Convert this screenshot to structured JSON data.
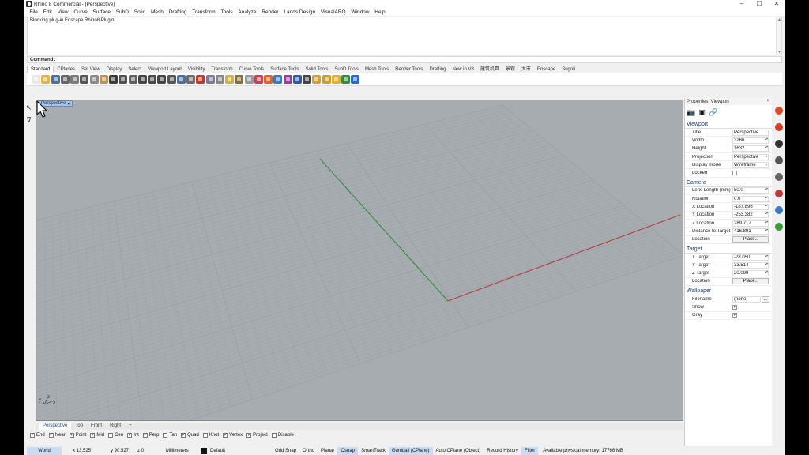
{
  "window": {
    "title": "Rhino 8 Commercial - [Perspective]",
    "controls": [
      "–",
      "☐",
      "✕"
    ]
  },
  "menu": [
    "File",
    "Edit",
    "View",
    "Curve",
    "Surface",
    "SubD",
    "Solid",
    "Mesh",
    "Drafting",
    "Transform",
    "Tools",
    "Analyze",
    "Render",
    "Lands Design",
    "VisualARQ",
    "Window",
    "Help"
  ],
  "command_history": [
    "Blocking plug-in Enscape.Rhino8.Plugin."
  ],
  "command_prompt": "Command:",
  "toolbar_tabs": [
    "Standard",
    "CPlanes",
    "Set View",
    "Display",
    "Select",
    "Viewport Layout",
    "Visibility",
    "Transform",
    "Curve Tools",
    "Surface Tools",
    "Solid Tools",
    "SubD Tools",
    "Mesh Tools",
    "Render Tools",
    "Drafting",
    "New in V8",
    "建筑机具",
    "景观",
    "大市",
    "Enscape",
    "Sugoii"
  ],
  "toolbar_active_tab": "Standard",
  "toolbar_icons": [
    {
      "name": "new-icon",
      "color": "#e8e8e8"
    },
    {
      "name": "open-icon",
      "color": "#e2b64a"
    },
    {
      "name": "save-icon",
      "color": "#4a6fa8"
    },
    {
      "name": "print-icon",
      "color": "#666666"
    },
    {
      "name": "import-icon",
      "color": "#7a7a7a"
    },
    {
      "name": "cut-icon",
      "color": "#555555"
    },
    {
      "name": "copy-icon",
      "color": "#8a8a8a"
    },
    {
      "name": "paste-icon",
      "color": "#b9935a"
    },
    {
      "name": "undo-icon",
      "color": "#3a3a3a"
    },
    {
      "name": "pan-icon",
      "color": "#505050"
    },
    {
      "name": "rotate-view-icon",
      "color": "#606060"
    },
    {
      "name": "zoom-icon",
      "color": "#454545"
    },
    {
      "name": "zoom-window-icon",
      "color": "#4a4a4a"
    },
    {
      "name": "zoom-extents-icon",
      "color": "#444444"
    },
    {
      "name": "zoom-selected-icon",
      "color": "#555555"
    },
    {
      "name": "four-viewports-icon",
      "color": "#4f6f9a"
    },
    {
      "name": "set-cplane-icon",
      "color": "#6d6d6d"
    },
    {
      "name": "car-icon",
      "color": "#c0392b"
    },
    {
      "name": "shaded-icon",
      "color": "#7a7a9a"
    },
    {
      "name": "target-icon",
      "color": "#888888"
    },
    {
      "name": "lightbulb-icon",
      "color": "#d4b13a"
    },
    {
      "name": "lock-icon",
      "color": "#8a6f3a"
    },
    {
      "name": "layer-icon",
      "color": "#9a9a9a"
    },
    {
      "name": "material-icon",
      "color": "#c0445a"
    },
    {
      "name": "color-wheel-icon",
      "color": "#e0622a"
    },
    {
      "name": "sphere-icon",
      "color": "#3a7ac0"
    },
    {
      "name": "render-icon",
      "color": "#9a3a9a"
    },
    {
      "name": "globe-icon",
      "color": "#2a5ab0"
    },
    {
      "name": "options-icon",
      "color": "#444444"
    },
    {
      "name": "paint-icon",
      "color": "#d4a02a"
    },
    {
      "name": "brush-icon",
      "color": "#c8a032"
    },
    {
      "name": "sun-icon",
      "color": "#e0b030"
    },
    {
      "name": "grasshopper-icon",
      "color": "#3a8a3a"
    },
    {
      "name": "help-icon",
      "color": "#2a6ad0"
    }
  ],
  "left_tools": [
    {
      "name": "select-arrow-icon",
      "glyph": "↖"
    },
    {
      "name": "filter-icon",
      "glyph": "⊽"
    }
  ],
  "viewport": {
    "label": "Perspective",
    "background": "#a7acb1",
    "grid_color": "#9aa0a6",
    "x_axis_color": "#b53a3a",
    "y_axis_color": "#2a8a3a",
    "tabs": [
      "Perspective",
      "Top",
      "Front",
      "Right",
      "+"
    ],
    "active_tab": "Perspective",
    "axis_y": "y",
    "axis_z": "z",
    "axis_x": "x"
  },
  "osnaps": [
    {
      "label": "End",
      "checked": true
    },
    {
      "label": "Near",
      "checked": true
    },
    {
      "label": "Point",
      "checked": true
    },
    {
      "label": "Mid",
      "checked": true
    },
    {
      "label": "Cen",
      "checked": false
    },
    {
      "label": "Int",
      "checked": true
    },
    {
      "label": "Perp",
      "checked": true
    },
    {
      "label": "Tan",
      "checked": false
    },
    {
      "label": "Quad",
      "checked": true
    },
    {
      "label": "Knot",
      "checked": false
    },
    {
      "label": "Vertex",
      "checked": true
    },
    {
      "label": "Project",
      "checked": true
    },
    {
      "label": "Disable",
      "checked": false
    }
  ],
  "status": {
    "cplane": "World",
    "x": "x 13.525",
    "y": "y 90.527",
    "z": "z 0",
    "units": "Millimeters",
    "layer": "Default",
    "toggles": [
      {
        "label": "Grid Snap",
        "on": false
      },
      {
        "label": "Ortho",
        "on": false
      },
      {
        "label": "Planar",
        "on": false
      },
      {
        "label": "Osnap",
        "on": true
      },
      {
        "label": "SmartTrack",
        "on": false
      },
      {
        "label": "Gumball (CPlane)",
        "on": true
      },
      {
        "label": "Auto CPlane (Object)",
        "on": false
      },
      {
        "label": "Record History",
        "on": false
      },
      {
        "label": "Filter",
        "on": true
      }
    ],
    "memory": "Available physical memory: 17766 MB"
  },
  "properties": {
    "panel_title": "Properties: Viewport",
    "close": "×",
    "panel_icons": [
      {
        "name": "camera-icon",
        "glyph": "📷"
      },
      {
        "name": "frame-icon",
        "glyph": "▣"
      },
      {
        "name": "texture-icon",
        "glyph": "🔗"
      }
    ],
    "sections": [
      {
        "title": "Viewport",
        "rows": [
          {
            "label": "Title",
            "value": "Perspective",
            "kind": "text"
          },
          {
            "label": "Width",
            "value": "3266",
            "kind": "spin"
          },
          {
            "label": "Height",
            "value": "1632",
            "kind": "spin"
          },
          {
            "label": "Projection",
            "value": "Perspective",
            "kind": "dd"
          },
          {
            "label": "Display mode",
            "value": "Wireframe",
            "kind": "dd"
          },
          {
            "label": "Locked",
            "value": "",
            "kind": "check",
            "checked": false
          }
        ]
      },
      {
        "title": "Camera",
        "rows": [
          {
            "label": "Lens Length (mm)",
            "value": "50.0",
            "kind": "spin"
          },
          {
            "label": "Rotation",
            "value": "0.0",
            "kind": "spin"
          },
          {
            "label": "X Location",
            "value": "-187.896",
            "kind": "spin"
          },
          {
            "label": "Y Location",
            "value": "-253.382",
            "kind": "spin"
          },
          {
            "label": "Z Location",
            "value": "289.717",
            "kind": "spin"
          },
          {
            "label": "Distance to Target",
            "value": "416.891",
            "kind": "spin"
          },
          {
            "label": "Location",
            "value": "Place...",
            "kind": "button"
          }
        ]
      },
      {
        "title": "Target",
        "rows": [
          {
            "label": "X Target",
            "value": "-28.050",
            "kind": "spin"
          },
          {
            "label": "Y Target",
            "value": "33.514",
            "kind": "spin"
          },
          {
            "label": "Z Target",
            "value": "20.099",
            "kind": "spin"
          },
          {
            "label": "Location",
            "value": "Place...",
            "kind": "button"
          }
        ]
      },
      {
        "title": "Wallpaper",
        "rows": [
          {
            "label": "Filename",
            "value": "(none)",
            "kind": "file"
          },
          {
            "label": "Show",
            "value": "",
            "kind": "check",
            "checked": true
          },
          {
            "label": "Gray",
            "value": "",
            "kind": "check",
            "checked": true
          }
        ]
      }
    ]
  },
  "right_icons": [
    {
      "name": "properties-panel-icon",
      "color": "#e04a2a"
    },
    {
      "name": "materials-panel-icon",
      "color": "#d0402a"
    },
    {
      "name": "display-panel-icon",
      "color": "#333333"
    },
    {
      "name": "layers-panel-icon",
      "color": "#555555"
    },
    {
      "name": "libraries-panel-icon",
      "color": "#666666"
    },
    {
      "name": "lights-panel-icon",
      "color": "#c03a3a"
    },
    {
      "name": "environment-panel-icon",
      "color": "#3a7ac0"
    },
    {
      "name": "render-panel-icon",
      "color": "#3a9a3a"
    }
  ]
}
